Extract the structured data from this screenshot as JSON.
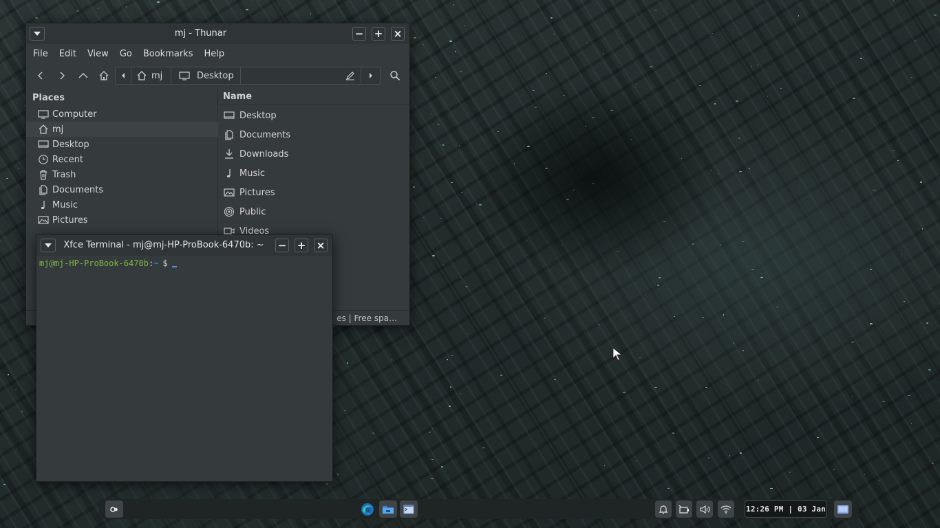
{
  "thunar": {
    "title": "mj - Thunar",
    "menu": [
      "File",
      "Edit",
      "View",
      "Go",
      "Bookmarks",
      "Help"
    ],
    "path": [
      "mj",
      "Desktop"
    ],
    "places_header": "Places",
    "places": [
      "Computer",
      "mj",
      "Desktop",
      "Recent",
      "Trash",
      "Documents",
      "Music",
      "Pictures"
    ],
    "name_column": "Name",
    "files": [
      "Desktop",
      "Documents",
      "Downloads",
      "Music",
      "Pictures",
      "Public",
      "Videos"
    ],
    "status": "es  |  Free spa…"
  },
  "terminal": {
    "title": "Xfce Terminal - mj@mj-HP-ProBook-6470b: ~",
    "prompt_user": "mj@mj-HP-ProBook-6470b",
    "prompt_colon": ":",
    "prompt_dir": "~",
    "prompt_symbol": "$"
  },
  "panel": {
    "clock": "12:26 PM | 03 Jan",
    "launchers": [
      "apps-icon",
      "browser-icon",
      "file-manager-icon",
      "terminal-icon"
    ],
    "tray": [
      "notification-bell-icon",
      "battery-icon",
      "volume-icon",
      "wifi-icon",
      "desktop-icon"
    ]
  },
  "colors": {
    "prompt_user": "#7fb547",
    "prompt_dir": "#5a8fd6",
    "window_bg": "#353a3c",
    "panel_bg": "#1f2425"
  }
}
